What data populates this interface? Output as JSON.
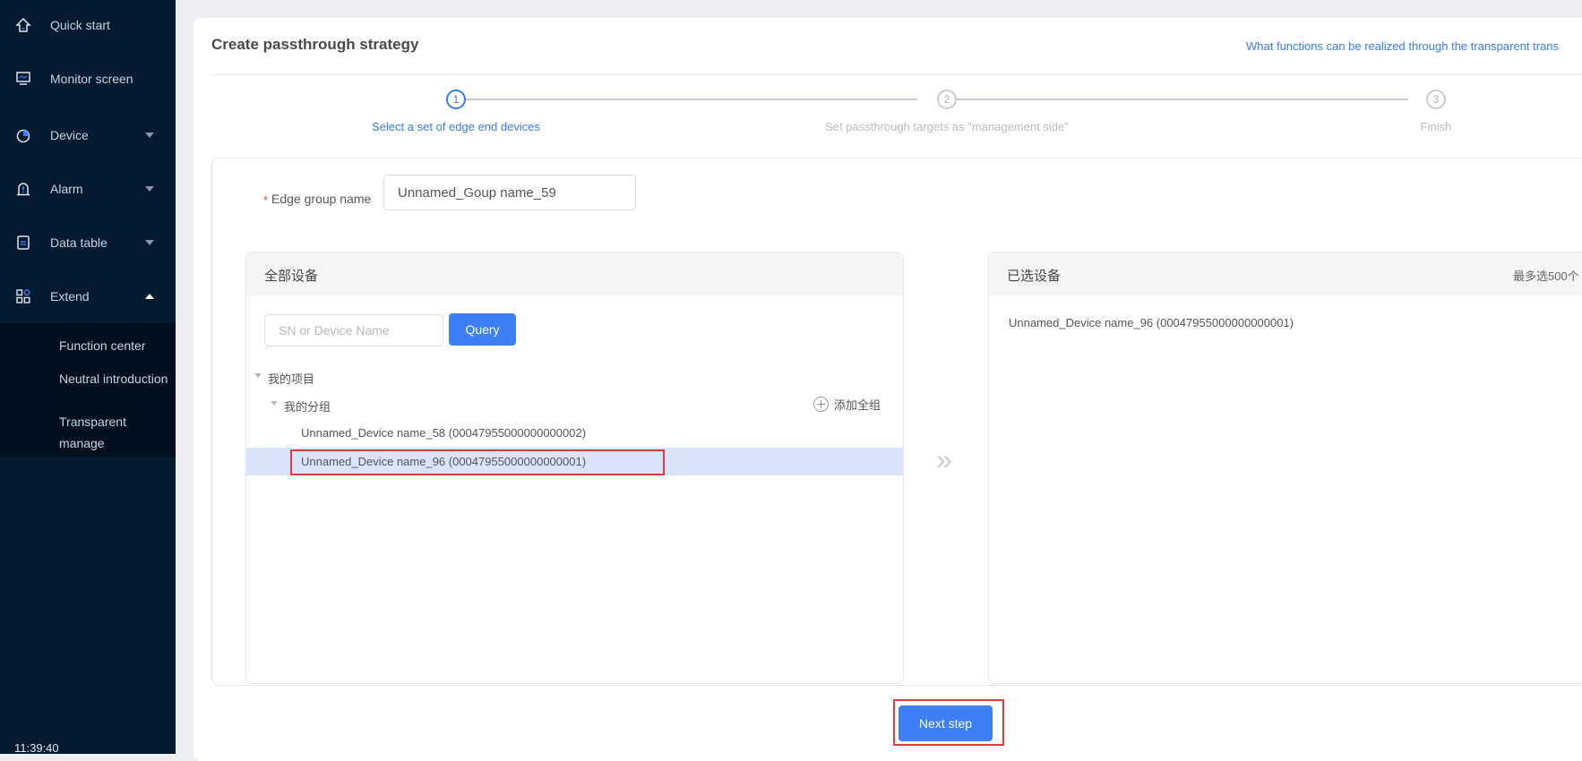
{
  "sidebar": {
    "items": [
      {
        "label": "Quick start",
        "icon": "home-icon",
        "expandable": false
      },
      {
        "label": "Monitor screen",
        "icon": "monitor-icon",
        "expandable": false
      },
      {
        "label": "Device",
        "icon": "pie-chart-icon",
        "expandable": true,
        "expanded": false
      },
      {
        "label": "Alarm",
        "icon": "alarm-bell-icon",
        "expandable": true,
        "expanded": false
      },
      {
        "label": "Data table",
        "icon": "table-icon",
        "expandable": true,
        "expanded": false
      },
      {
        "label": "Extend",
        "icon": "apps-grid-icon",
        "expandable": true,
        "expanded": true
      }
    ],
    "submenu": [
      {
        "label": "Function center"
      },
      {
        "label": "Neutral introduction"
      },
      {
        "label": "Transparent manage"
      }
    ],
    "clock": "11:39:40"
  },
  "page": {
    "title": "Create passthrough strategy",
    "help_link": "What functions can be realized through the transparent trans"
  },
  "steps": [
    {
      "number": "1",
      "label": "Select a set of edge end devices",
      "active": true
    },
    {
      "number": "2",
      "label": "Set passthrough targets as \"management side\"",
      "active": false
    },
    {
      "number": "3",
      "label": "Finish",
      "active": false
    }
  ],
  "form": {
    "required_mark": "*",
    "group_name_label": "Edge group name",
    "group_name_value": "Unnamed_Goup name_59"
  },
  "transfer": {
    "left": {
      "title": "全部设备",
      "search_placeholder": "SN or Device Name",
      "query_label": "Query",
      "tree": {
        "project": "我的项目",
        "group": "我的分组",
        "add_all_label": "添加全组",
        "devices": [
          {
            "label": "Unnamed_Device name_58 (00047955000000000002)",
            "selected": false
          },
          {
            "label": "Unnamed_Device name_96 (00047955000000000001)",
            "selected": true
          }
        ]
      }
    },
    "arrow": "»",
    "right": {
      "title": "已选设备",
      "limit": "最多选500个",
      "items": [
        {
          "label": "Unnamed_Device name_96  (00047955000000000001)"
        }
      ]
    }
  },
  "footer": {
    "next_label": "Next step"
  },
  "colors": {
    "sidebar_bg": "#031a31",
    "accent": "#3d7ff5",
    "highlight_outline": "#e23b3b",
    "selected_row": "#d9e4fb"
  }
}
